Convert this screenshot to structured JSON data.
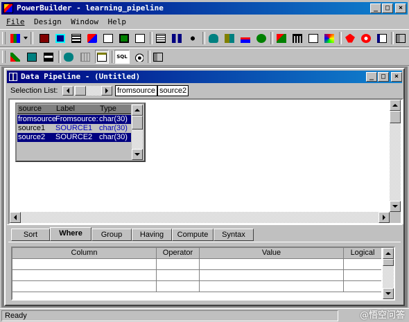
{
  "app": {
    "title": "PowerBuilder - learning_pipeline",
    "caption_buttons": [
      "_",
      "□",
      "×"
    ]
  },
  "menu": [
    {
      "label": "File",
      "access": "F"
    },
    {
      "label": "Design",
      "access": "D"
    },
    {
      "label": "Window",
      "access": "W"
    },
    {
      "label": "Help",
      "access": "H"
    }
  ],
  "toolbar1_icons": [
    "painter-icon",
    "application-icon",
    "window-icon",
    "menu-icon",
    "datawindow-icon",
    "structure-icon",
    "user-object-icon",
    "function-icon",
    "query-icon",
    "pipeline-icon",
    "project-icon",
    "database-icon",
    "database-profile-icon",
    "data-manipulation-icon",
    "library-icon",
    "debug-icon",
    "library-list-icon",
    "file-editor-icon",
    "color-palette-icon",
    "run-icon",
    "stop-icon",
    "preview-icon",
    "exit-icon"
  ],
  "toolbar2_icons": [
    "execute-icon",
    "new-icon",
    "save-icon",
    "database-blob-icon",
    "table-icon",
    "paste-icon",
    "sql-icon",
    "sql-select-icon",
    "close-painter-icon"
  ],
  "child_window": {
    "title": "Data Pipeline - (Untitled)",
    "caption_buttons": [
      "_",
      "□",
      "×"
    ]
  },
  "selection_list": {
    "label": "Selection List:",
    "tables": [
      "fromsource",
      "source2"
    ]
  },
  "column_box": {
    "headers": [
      "source",
      "Label",
      "Type"
    ],
    "rows": [
      {
        "name": "fromsource",
        "label": "Fromsource:",
        "type": "char(30)",
        "selected": true
      },
      {
        "name": "source1",
        "label": "SOURCE1",
        "type": "char(30)",
        "selected": false
      },
      {
        "name": "source2",
        "label": "SOURCE2",
        "type": "char(30)",
        "selected": true
      }
    ]
  },
  "tabs": [
    {
      "label": "Sort",
      "active": false
    },
    {
      "label": "Where",
      "active": true
    },
    {
      "label": "Group",
      "active": false
    },
    {
      "label": "Having",
      "active": false
    },
    {
      "label": "Compute",
      "active": false
    },
    {
      "label": "Syntax",
      "active": false
    }
  ],
  "where_grid": {
    "headers": [
      "Column",
      "Operator",
      "Value",
      "Logical"
    ],
    "rows": 3
  },
  "status": {
    "text": "Ready"
  },
  "watermark": "@悟空问答"
}
